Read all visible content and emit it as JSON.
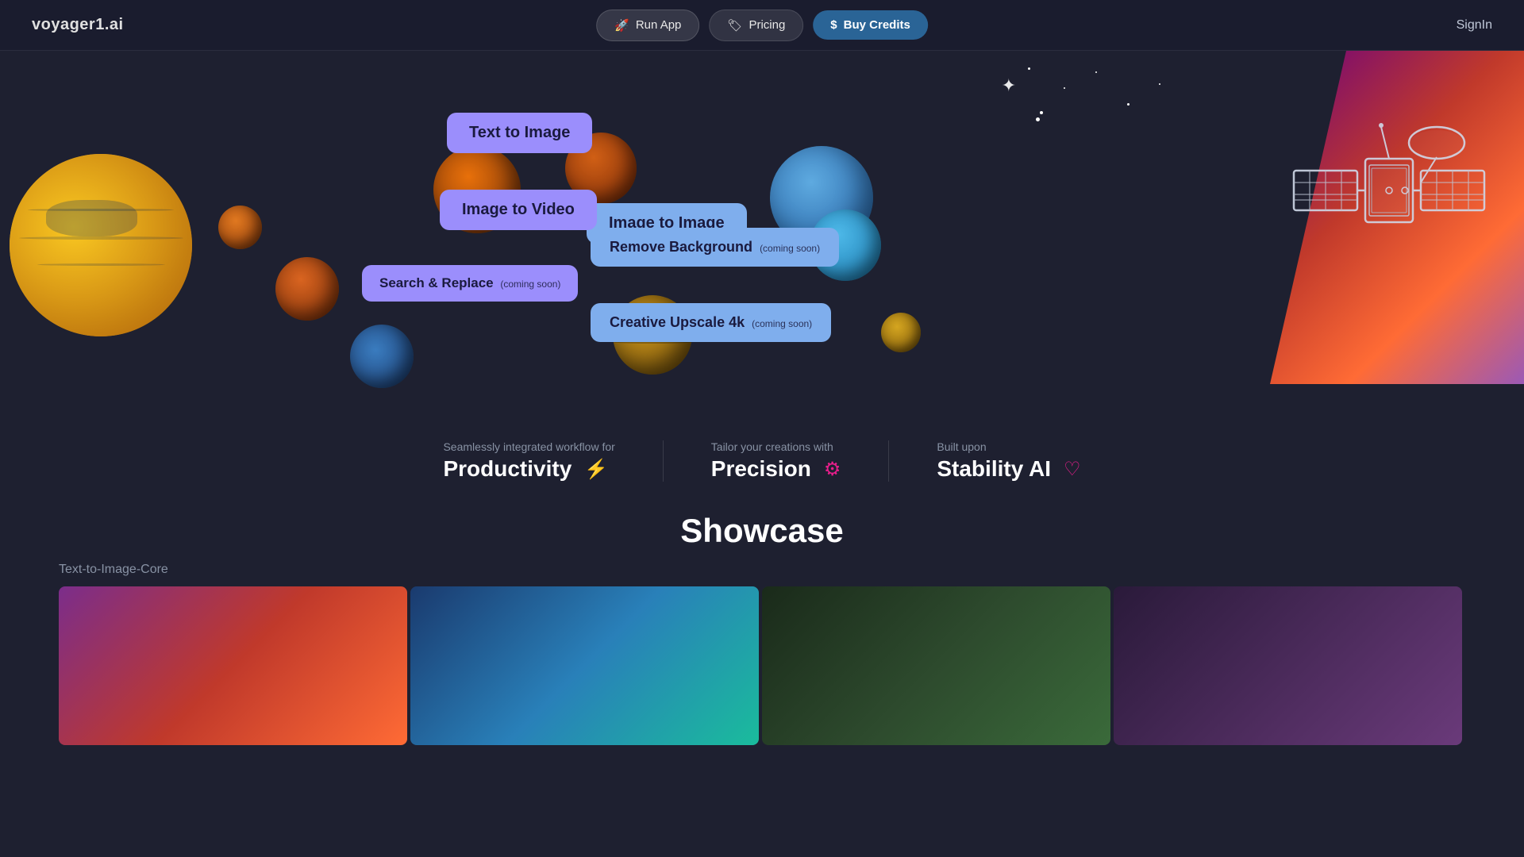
{
  "header": {
    "logo": "voyager1.ai",
    "nav": {
      "run_app": "Run App",
      "pricing": "Pricing",
      "buy_credits": "Buy Credits",
      "signin": "SignIn"
    }
  },
  "hero": {
    "pills": [
      {
        "id": "text-to-image",
        "label": "Text to Image",
        "coming_soon": false
      },
      {
        "id": "image-to-image",
        "label": "Image to Image",
        "coming_soon": false
      },
      {
        "id": "image-to-video",
        "label": "Image to Video",
        "coming_soon": false
      },
      {
        "id": "remove-background",
        "label": "Remove Background",
        "coming_soon": true
      },
      {
        "id": "search-replace",
        "label": "Search & Replace",
        "coming_soon": true
      },
      {
        "id": "creative-upscale",
        "label": "Creative Upscale 4k",
        "coming_soon": true
      }
    ],
    "coming_soon_text": "(coming soon)"
  },
  "features": [
    {
      "id": "productivity",
      "label_small": "Seamlessly integrated workflow for",
      "label_large": "Productivity",
      "icon": "⚡"
    },
    {
      "id": "precision",
      "label_small": "Tailor your creations with",
      "label_large": "Precision",
      "icon": "⚙"
    },
    {
      "id": "stability",
      "label_small": "Built upon",
      "label_large": "Stability AI",
      "icon": "♡"
    }
  ],
  "showcase": {
    "title": "Showcase",
    "subtitle": "Text-to-Image-Core"
  }
}
